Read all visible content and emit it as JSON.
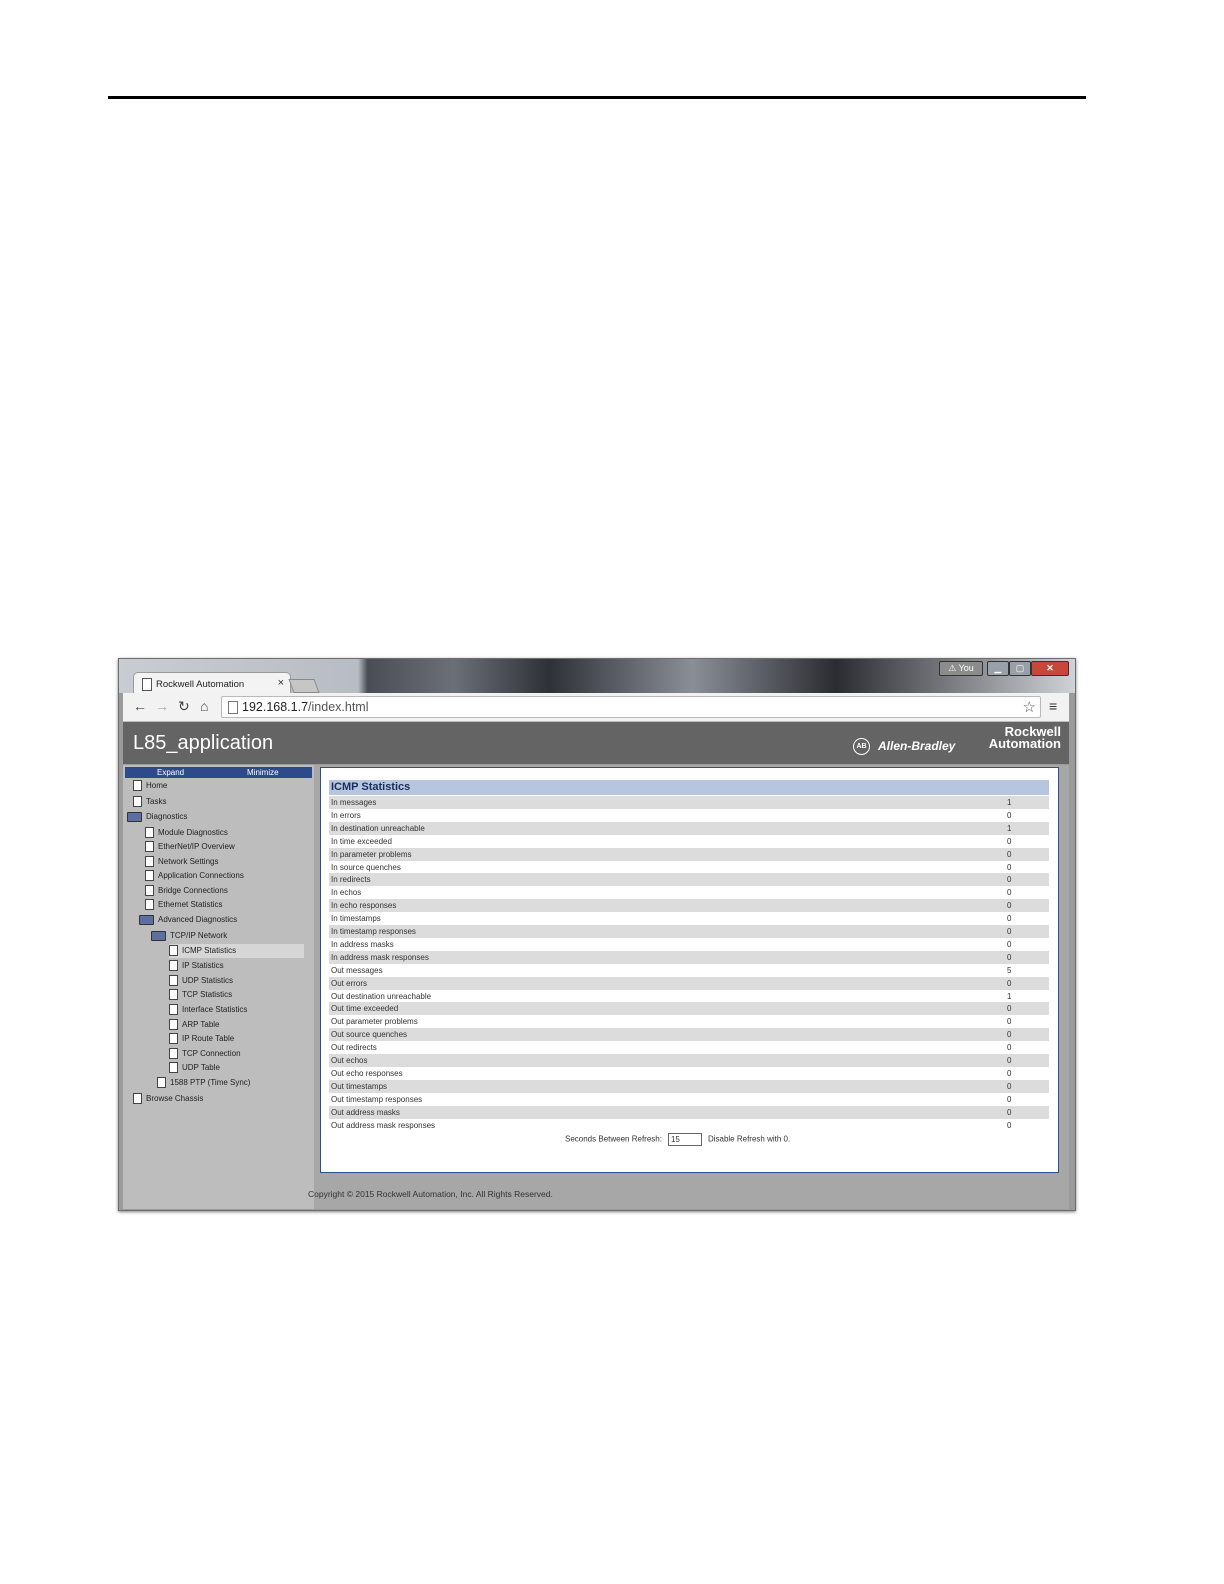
{
  "browser": {
    "tab_title": "Rockwell Automation",
    "tab_close": "×",
    "profile_label": "You",
    "url_host": "192.168.1.7",
    "url_path": "/index.html"
  },
  "app": {
    "title": "L85_application",
    "brand_ab_badge": "AB",
    "brand_ab": "Allen-Bradley",
    "brand_ra_line1": "Rockwell",
    "brand_ra_line2": "Automation"
  },
  "sidebar": {
    "expand": "Expand",
    "minimize": "Minimize",
    "items": [
      {
        "label": "Home",
        "icon": "document-icon"
      },
      {
        "label": "Tasks",
        "icon": "document-icon"
      },
      {
        "label": "Diagnostics",
        "icon": "folder-icon"
      },
      {
        "label": "Module Diagnostics",
        "icon": "document-icon"
      },
      {
        "label": "EtherNet/IP Overview",
        "icon": "document-icon"
      },
      {
        "label": "Network Settings",
        "icon": "document-icon"
      },
      {
        "label": "Application Connections",
        "icon": "document-icon"
      },
      {
        "label": "Bridge Connections",
        "icon": "document-icon"
      },
      {
        "label": "Ethernet Statistics",
        "icon": "document-icon"
      },
      {
        "label": "Advanced Diagnostics",
        "icon": "folder-icon"
      },
      {
        "label": "TCP/IP Network",
        "icon": "folder-icon"
      },
      {
        "label": "ICMP Statistics",
        "icon": "document-icon",
        "selected": true
      },
      {
        "label": "IP Statistics",
        "icon": "document-icon"
      },
      {
        "label": "UDP Statistics",
        "icon": "document-icon"
      },
      {
        "label": "TCP Statistics",
        "icon": "document-icon"
      },
      {
        "label": "Interface Statistics",
        "icon": "document-icon"
      },
      {
        "label": "ARP Table",
        "icon": "document-icon"
      },
      {
        "label": "IP Route Table",
        "icon": "document-icon"
      },
      {
        "label": "TCP Connection",
        "icon": "document-icon"
      },
      {
        "label": "UDP Table",
        "icon": "document-icon"
      },
      {
        "label": "1588 PTP (Time Sync)",
        "icon": "document-icon"
      },
      {
        "label": "Browse Chassis",
        "icon": "document-icon"
      }
    ]
  },
  "main": {
    "title": "ICMP Statistics",
    "rows": [
      {
        "label": "In messages",
        "value": "1"
      },
      {
        "label": "In errors",
        "value": "0"
      },
      {
        "label": "In destination unreachable",
        "value": "1"
      },
      {
        "label": "In time exceeded",
        "value": "0"
      },
      {
        "label": "In parameter problems",
        "value": "0"
      },
      {
        "label": "In source quenches",
        "value": "0"
      },
      {
        "label": "In redirects",
        "value": "0"
      },
      {
        "label": "In echos",
        "value": "0"
      },
      {
        "label": "In echo responses",
        "value": "0"
      },
      {
        "label": "In timestamps",
        "value": "0"
      },
      {
        "label": "In timestamp responses",
        "value": "0"
      },
      {
        "label": "In address masks",
        "value": "0"
      },
      {
        "label": "In address mask responses",
        "value": "0"
      },
      {
        "label": "Out messages",
        "value": "5"
      },
      {
        "label": "Out errors",
        "value": "0"
      },
      {
        "label": "Out destination unreachable",
        "value": "1"
      },
      {
        "label": "Out time exceeded",
        "value": "0"
      },
      {
        "label": "Out parameter problems",
        "value": "0"
      },
      {
        "label": "Out source quenches",
        "value": "0"
      },
      {
        "label": "Out redirects",
        "value": "0"
      },
      {
        "label": "Out echos",
        "value": "0"
      },
      {
        "label": "Out echo responses",
        "value": "0"
      },
      {
        "label": "Out timestamps",
        "value": "0"
      },
      {
        "label": "Out timestamp responses",
        "value": "0"
      },
      {
        "label": "Out address masks",
        "value": "0"
      },
      {
        "label": "Out address mask responses",
        "value": "0"
      }
    ],
    "refresh_label": "Seconds Between Refresh:",
    "refresh_value": "15",
    "refresh_hint": "Disable Refresh with 0."
  },
  "footer": {
    "copyright": "Copyright © 2015 Rockwell Automation, Inc. All Rights Reserved."
  }
}
